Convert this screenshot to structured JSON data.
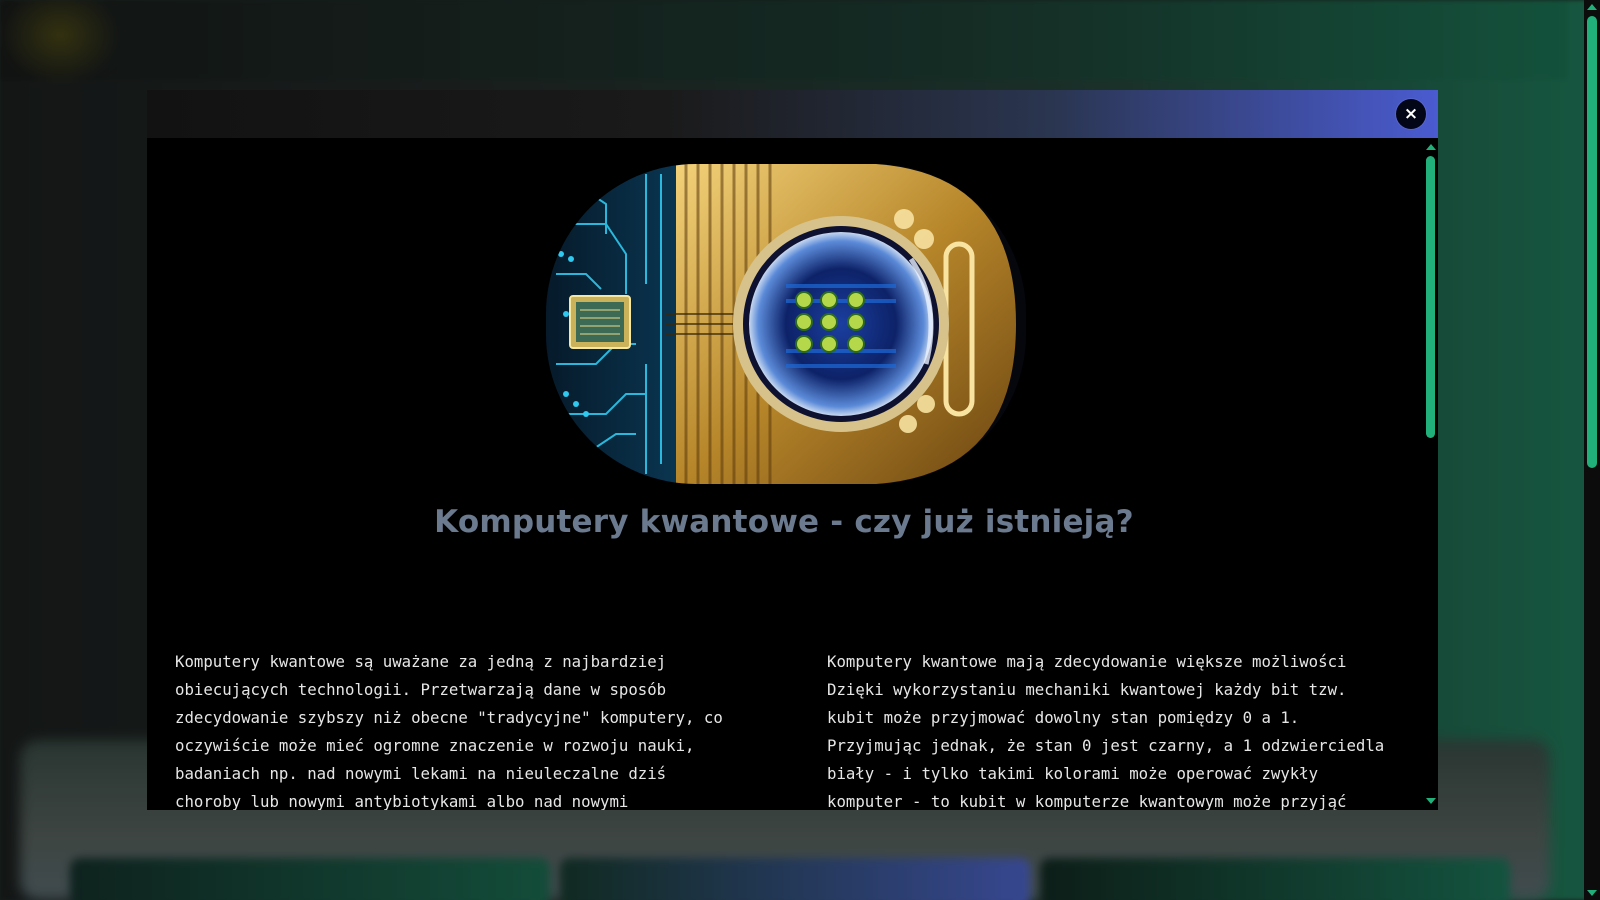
{
  "modal": {
    "close_label": "×",
    "title": "Komputery kwantowe - czy już istnieją?",
    "columns": {
      "left": [
        "Komputery kwantowe są uważane za jedną z najbardziej",
        "obiecujących technologii. Przetwarzają dane w sposób",
        "zdecydowanie szybszy niż obecne \"tradycyjne\" komputery, co",
        "oczywiście może mieć ogromne znaczenie w rozwoju nauki,",
        "badaniach np. nad nowymi lekami na nieuleczalne dziś",
        "choroby lub nowymi antybiotykami albo nad nowymi"
      ],
      "right": [
        "Komputery kwantowe mają zdecydowanie większe możliwości",
        "Dzięki wykorzystaniu mechaniki kwantowej każdy bit tzw.",
        "kubit może przyjmować dowolny stan pomiędzy 0 a 1.",
        "Przyjmując jednak, że stan 0 jest czarny, a 1 odzwierciedla",
        "biały - i tylko takimi kolorami może operować zwykły",
        "komputer - to kubit w komputerze kwantowym może przyjąć"
      ]
    }
  },
  "colors": {
    "accent": "#22b07a",
    "title": "#6b7a8f",
    "header_gradient_end": "#4a5bd0"
  },
  "icons": {
    "close": "close-icon",
    "hero_image": "quantum-chip-illustration"
  }
}
